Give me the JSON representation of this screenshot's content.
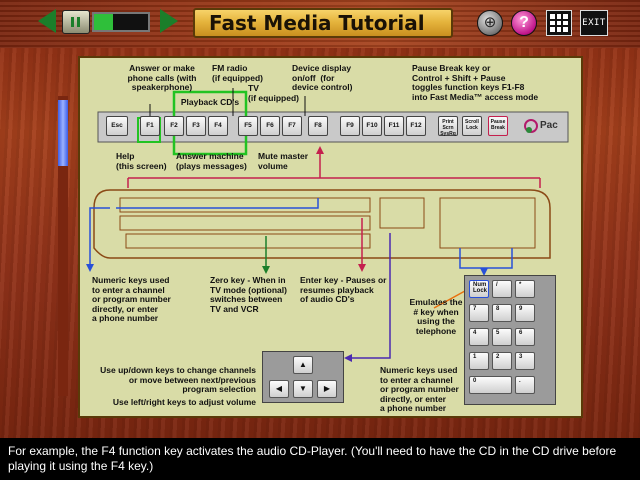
{
  "window": {
    "title": "Fast Media Tutorial"
  },
  "toolbar": {
    "prev_icon": "triangle-left-icon",
    "pause_icon": "pause-icon",
    "next_icon": "triangle-right-icon",
    "progress_fraction": 0.35,
    "globe_icon": "globe-icon",
    "help_label": "?",
    "grid_icon": "grid-menu-icon",
    "exit_label": "EXIT"
  },
  "keyboard": {
    "fkeys": [
      "Esc",
      "F1",
      "F2",
      "F3",
      "F4",
      "F5",
      "F6",
      "F7",
      "F8",
      "F9",
      "F10",
      "F11",
      "F12",
      "Print Scrn SysRq",
      "Scroll Lock",
      "Pause Break"
    ],
    "brand_text": "Pac",
    "numpad_keys": [
      "Num Lock",
      "/",
      "*",
      "7",
      "8",
      "9",
      "4",
      "5",
      "6",
      "1",
      "2",
      "3",
      "0",
      "."
    ],
    "arrow_keys": [
      "▲",
      "◀",
      "▼",
      "▶"
    ]
  },
  "annotations": {
    "answer_calls": "Answer or make\nphone calls (with\nspeakerphone)",
    "fm_radio": "FM radio\n(if equipped)",
    "playback_cds": "Playback CD's",
    "tv": "TV\n(if equipped)",
    "device_display": "Device display\non/off  (for\ndevice control)",
    "pause_break": "Pause Break key or\nControl + Shift + Pause\ntoggles function keys F1-F8\ninto Fast Media™ access mode",
    "help": "Help\n(this screen)",
    "answer_machine": "Answer machine\n(plays messages)",
    "mute": "Mute master\nvolume",
    "numeric_left": "Numeric keys used\nto enter a channel\nor program number\ndirectly, or enter\na phone number",
    "zero_key": "Zero key - When in\nTV mode (optional)\nswitches between\nTV and VCR",
    "enter_key": "Enter key - Pauses or\nresumes playback\nof audio CD's",
    "emulates": "Emulates the\n# key when\nusing the\ntelephone",
    "updown": "Use up/down keys to change channels\nor move between next/previous\nprogram selection",
    "leftright": "Use left/right keys to adjust volume",
    "numeric_right": "Numeric keys used\nto enter a channel\nor program number\ndirectly, or enter\na phone number"
  },
  "caption": "For example, the F4 function key activates the audio CD-Player.  (You'll need to have the CD in the CD drive before playing it using the F4 key.)"
}
